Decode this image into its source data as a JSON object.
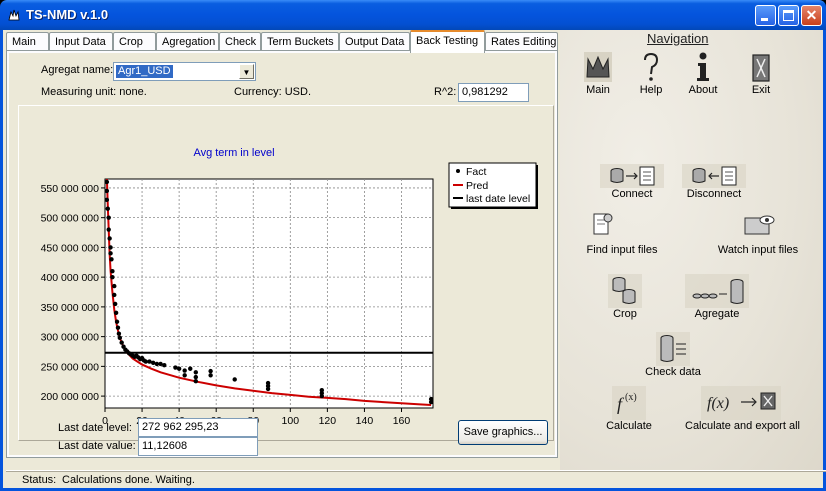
{
  "window": {
    "title": "TS-NMD v.1.0"
  },
  "tabs": [
    "Main",
    "Input Data",
    "Crop",
    "Agregation",
    "Check",
    "Term Buckets",
    "Output Data",
    "Back Testing",
    "Rates Editing"
  ],
  "active_tab": "Back Testing",
  "form": {
    "agregat_label": "Agregat name:",
    "agregat_value": "Agr1_USD",
    "measuring_unit": "Measuring unit: none.",
    "currency": "Currency: USD.",
    "r2_label": "R^2:",
    "r2_value": "0,981292",
    "last_date_level_label": "Last date level:",
    "last_date_level_value": "272 962 295,23",
    "last_date_value_label": "Last date value:",
    "last_date_value_value": "11,12608",
    "save_button": "Save graphics..."
  },
  "status": {
    "label": "Status:",
    "text": "Calculations done. Waiting."
  },
  "navigation": {
    "title": "Navigation",
    "main": "Main",
    "help": "Help",
    "about": "About",
    "exit": "Exit",
    "connect": "Connect",
    "disconnect": "Disconnect",
    "find_input_files": "Find input files",
    "watch_input_files": "Watch input files",
    "crop": "Crop",
    "agregate": "Agregate",
    "check_data": "Check data",
    "calculate": "Calculate",
    "calculate_export_all": "Calculate and export all"
  },
  "chart_data": {
    "type": "scatter+line",
    "title": "Avg term in level",
    "xlim": [
      0,
      177
    ],
    "ylim": [
      180000000,
      565000000
    ],
    "xticks": [
      0,
      20,
      40,
      60,
      80,
      100,
      120,
      140,
      160
    ],
    "yticks": [
      200000000,
      250000000,
      300000000,
      350000000,
      400000000,
      450000000,
      500000000,
      550000000
    ],
    "ytick_labels": [
      "200 000 000",
      "250 000 000",
      "300 000 000",
      "350 000 000",
      "400 000 000",
      "450 000 000",
      "500 000 000",
      "550 000 000"
    ],
    "legend": [
      "Fact",
      "Pred",
      "last date level"
    ],
    "colors": {
      "fact": "#000000",
      "pred": "#cc0000",
      "level": "#000000",
      "title": "#0000cc"
    },
    "last_date_level": 272962295.23,
    "fact": [
      [
        1,
        560000000
      ],
      [
        1,
        545000000
      ],
      [
        1,
        530000000
      ],
      [
        1.5,
        515000000
      ],
      [
        2,
        500000000
      ],
      [
        2,
        480000000
      ],
      [
        2.5,
        465000000
      ],
      [
        3,
        450000000
      ],
      [
        3,
        440000000
      ],
      [
        3.5,
        430000000
      ],
      [
        4,
        410000000
      ],
      [
        4,
        400000000
      ],
      [
        5,
        385000000
      ],
      [
        5,
        370000000
      ],
      [
        5.5,
        355000000
      ],
      [
        6,
        340000000
      ],
      [
        6.5,
        325000000
      ],
      [
        7,
        315000000
      ],
      [
        7.5,
        305000000
      ],
      [
        8,
        298000000
      ],
      [
        9,
        290000000
      ],
      [
        10,
        283000000
      ],
      [
        11,
        278000000
      ],
      [
        12,
        275000000
      ],
      [
        13,
        272000000
      ],
      [
        14,
        270000000
      ],
      [
        15,
        268000000
      ],
      [
        16,
        266000000
      ],
      [
        17,
        268000000
      ],
      [
        18,
        265000000
      ],
      [
        19,
        262000000
      ],
      [
        20,
        264000000
      ],
      [
        21,
        260000000
      ],
      [
        22,
        258000000
      ],
      [
        24,
        258000000
      ],
      [
        26,
        256000000
      ],
      [
        28,
        254000000
      ],
      [
        30,
        254000000
      ],
      [
        32,
        252000000
      ],
      [
        38,
        248000000
      ],
      [
        40,
        246000000
      ],
      [
        43,
        243000000
      ],
      [
        43,
        235000000
      ],
      [
        46,
        246000000
      ],
      [
        49,
        240000000
      ],
      [
        49,
        232000000
      ],
      [
        49,
        225000000
      ],
      [
        57,
        242000000
      ],
      [
        57,
        235000000
      ],
      [
        70,
        228000000
      ],
      [
        88,
        222000000
      ],
      [
        88,
        217000000
      ],
      [
        88,
        212000000
      ],
      [
        117,
        210000000
      ],
      [
        117,
        205000000
      ],
      [
        117,
        200000000
      ],
      [
        176,
        195000000
      ],
      [
        176,
        190000000
      ]
    ],
    "pred": [
      [
        1,
        565000000
      ],
      [
        1.5,
        520000000
      ],
      [
        2,
        480000000
      ],
      [
        2.5,
        440000000
      ],
      [
        3,
        410000000
      ],
      [
        4,
        375000000
      ],
      [
        5,
        345000000
      ],
      [
        6,
        325000000
      ],
      [
        7,
        310000000
      ],
      [
        8,
        298000000
      ],
      [
        10,
        283000000
      ],
      [
        12,
        273000000
      ],
      [
        15,
        263000000
      ],
      [
        20,
        253000000
      ],
      [
        25,
        246000000
      ],
      [
        30,
        240000000
      ],
      [
        40,
        231000000
      ],
      [
        50,
        224000000
      ],
      [
        60,
        218000000
      ],
      [
        70,
        213000000
      ],
      [
        80,
        209000000
      ],
      [
        90,
        205000000
      ],
      [
        100,
        202000000
      ],
      [
        110,
        199000000
      ],
      [
        120,
        197000000
      ],
      [
        130,
        195000000
      ],
      [
        140,
        192000000
      ],
      [
        150,
        190000000
      ],
      [
        160,
        188000000
      ],
      [
        170,
        186000000
      ],
      [
        176,
        185000000
      ]
    ]
  }
}
